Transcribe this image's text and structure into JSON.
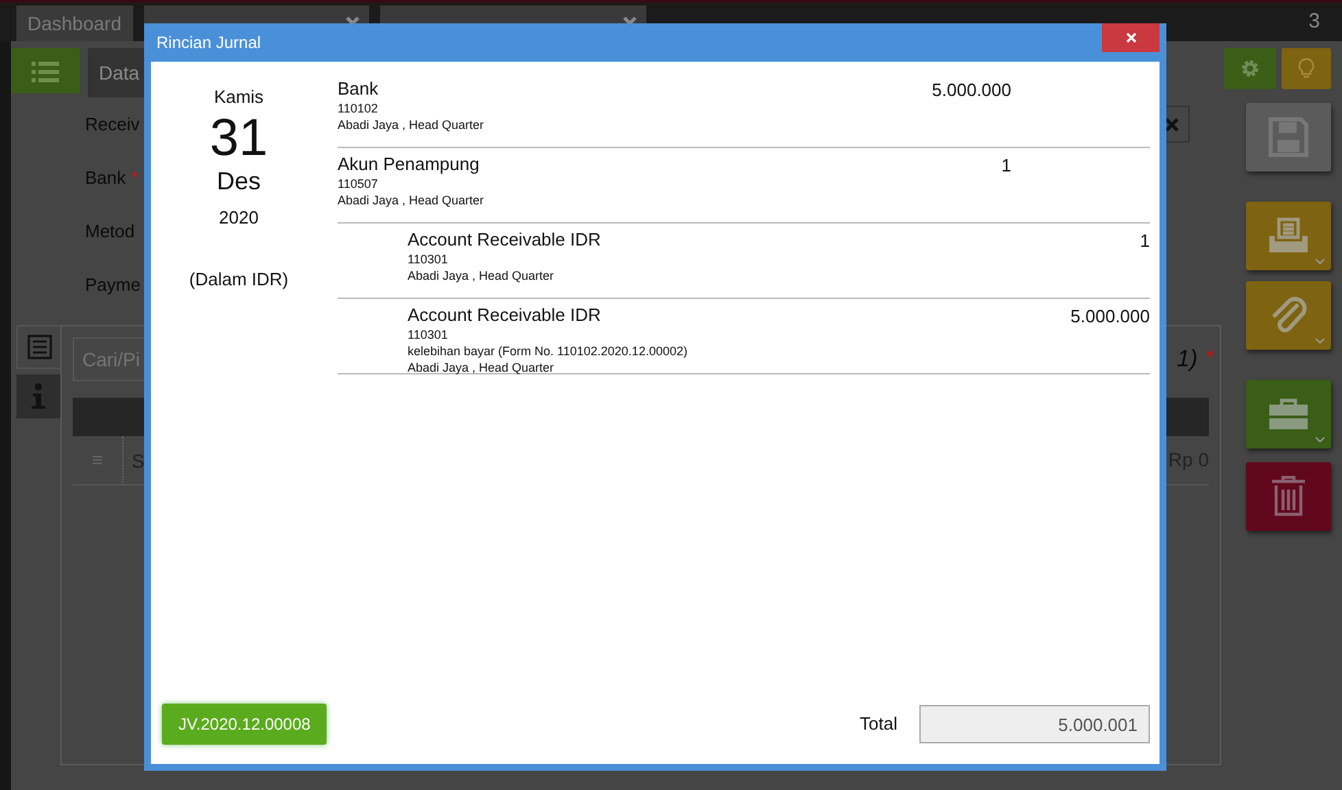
{
  "app": {
    "tabs": [
      {
        "label": "Dashboard",
        "closable": false
      },
      {
        "closable": true
      },
      {
        "closable": true
      }
    ],
    "tab_count": "3",
    "data_tab": "Data",
    "form_labels": [
      {
        "text": "Receiv"
      },
      {
        "text": "Bank",
        "required_mark": "*"
      },
      {
        "text": "Metod"
      },
      {
        "text": "Payme"
      }
    ],
    "search": {
      "placeholder": "Cari/Pi"
    },
    "count_label": "1)",
    "count_mark": "*",
    "drag_handle": "≡",
    "row_cell": "S",
    "row_amount": "Rp 0"
  },
  "dialog": {
    "title": "Rincian Jurnal",
    "date": {
      "weekday": "Kamis",
      "day": "31",
      "month": "Des",
      "year": "2020",
      "currency_note": "(Dalam IDR)"
    },
    "entries": [
      {
        "account": "Bank",
        "code": "110102",
        "branch": "Abadi Jaya , Head Quarter",
        "amount": "5.000.000",
        "kind": "debit"
      },
      {
        "account": "Akun Penampung",
        "code": "110507",
        "branch": "Abadi Jaya , Head Quarter",
        "amount": "1",
        "kind": "debit"
      },
      {
        "account": "Account Receivable IDR",
        "code": "110301",
        "branch": "Abadi Jaya , Head Quarter",
        "amount": "1",
        "kind": "credit"
      },
      {
        "account": "Account Receivable IDR",
        "code": "110301",
        "memo": "kelebihan bayar (Form No. 110102.2020.12.00002)",
        "branch": "Abadi Jaya , Head Quarter",
        "amount": "5.000.000",
        "kind": "credit"
      }
    ],
    "journal_button": "JV.2020.12.00008",
    "total_label": "Total",
    "total_value": "5.000.001"
  }
}
